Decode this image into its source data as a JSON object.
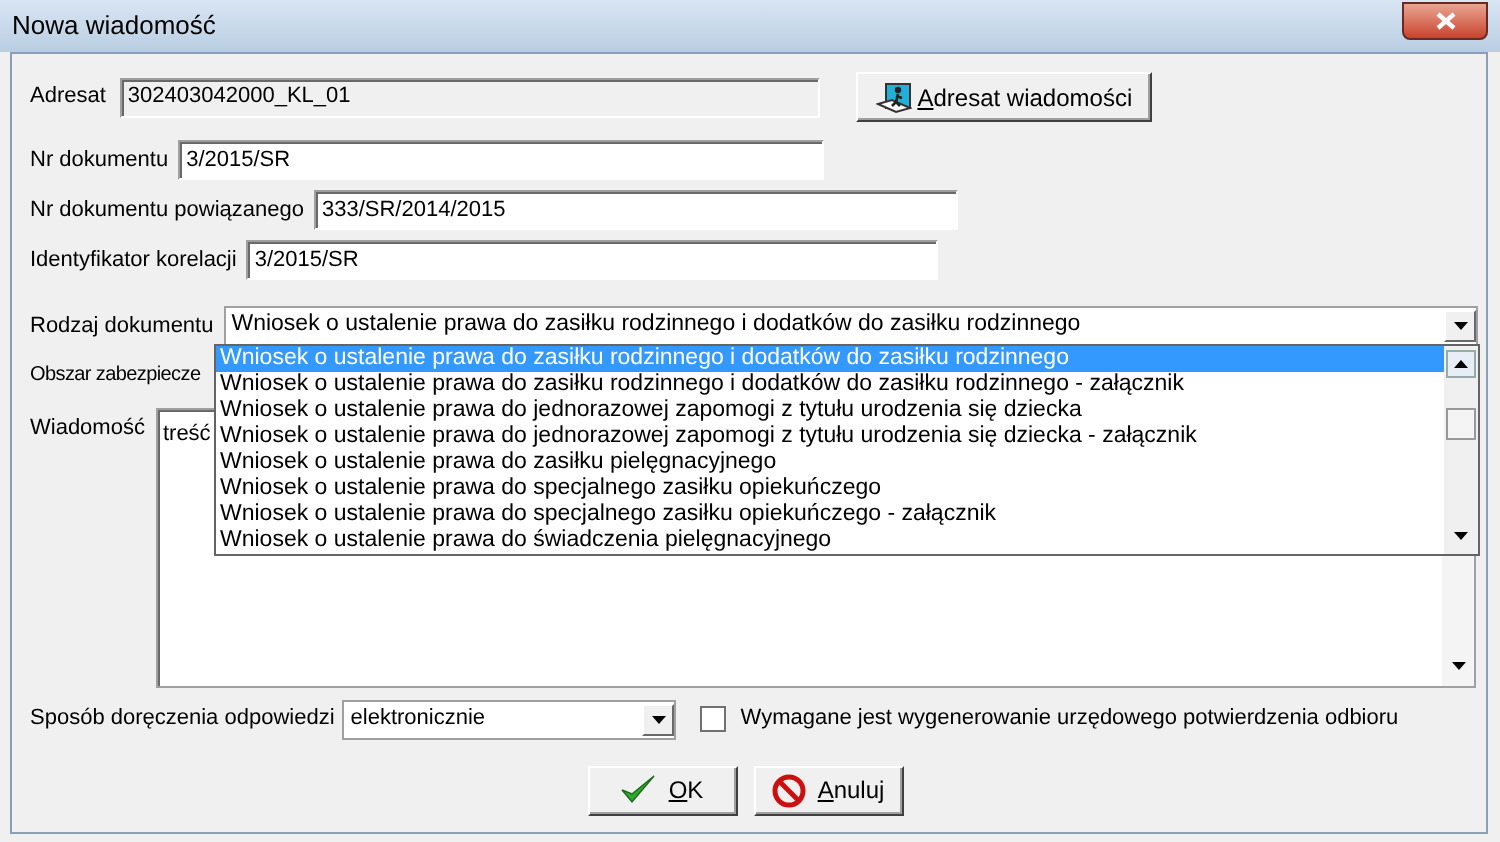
{
  "window": {
    "title": "Nowa wiadomość"
  },
  "recipient": {
    "label": "Adresat",
    "value": "302403042000_KL_01",
    "disabled": true,
    "button": "Adresat wiadomości"
  },
  "fields": [
    {
      "label": "Nr dokumentu",
      "value": "3/2015/SR"
    },
    {
      "label": "Nr dokumentu powiązanego",
      "value": "333/SR/2014/2015"
    },
    {
      "label": "Identyfikator korelacji",
      "value": "3/2015/SR"
    }
  ],
  "document_type": {
    "label": "Rodzaj dokumentu",
    "value": "Wniosek o ustalenie prawa do zasiłku rodzinnego i dodatków do zasiłku rodzinnego",
    "expanded": true,
    "options": [
      {
        "label": "Wniosek o ustalenie prawa do zasiłku rodzinnego i dodatków do zasiłku rodzinnego",
        "selected": true
      },
      {
        "label": "Wniosek o ustalenie prawa do zasiłku rodzinnego i dodatków do zasiłku rodzinnego - załącznik",
        "selected": false
      },
      {
        "label": "Wniosek o ustalenie prawa do jednorazowej zapomogi z tytułu urodzenia się dziecka",
        "selected": false
      },
      {
        "label": "Wniosek o ustalenie prawa do jednorazowej zapomogi z tytułu urodzenia się dziecka - załącznik",
        "selected": false
      },
      {
        "label": "Wniosek o ustalenie prawa do zasiłku pielęgnacyjnego",
        "selected": false
      },
      {
        "label": "Wniosek o ustalenie prawa do specjalnego zasiłku opiekuńczego",
        "selected": false
      },
      {
        "label": "Wniosek o ustalenie prawa do specjalnego zasiłku opiekuńczego - załącznik",
        "selected": false
      },
      {
        "label": "Wniosek o ustalenie prawa do świadczenia pielęgnacyjnego",
        "selected": false
      }
    ]
  },
  "security_area": {
    "label": "Obszar zabezpiecze"
  },
  "message": {
    "label": "Wiadomość",
    "value": "treść"
  },
  "delivery": {
    "label": "Sposób doręczenia odpowiedzi",
    "value": "elektronicznie"
  },
  "receipt_checkbox": {
    "label": "Wymagane jest wygenerowanie urzędowego potwierdzenia odbioru",
    "checked": false
  },
  "buttons": [
    {
      "label": "OK",
      "kind": "ok"
    },
    {
      "label": "Anuluj",
      "kind": "cancel"
    }
  ]
}
